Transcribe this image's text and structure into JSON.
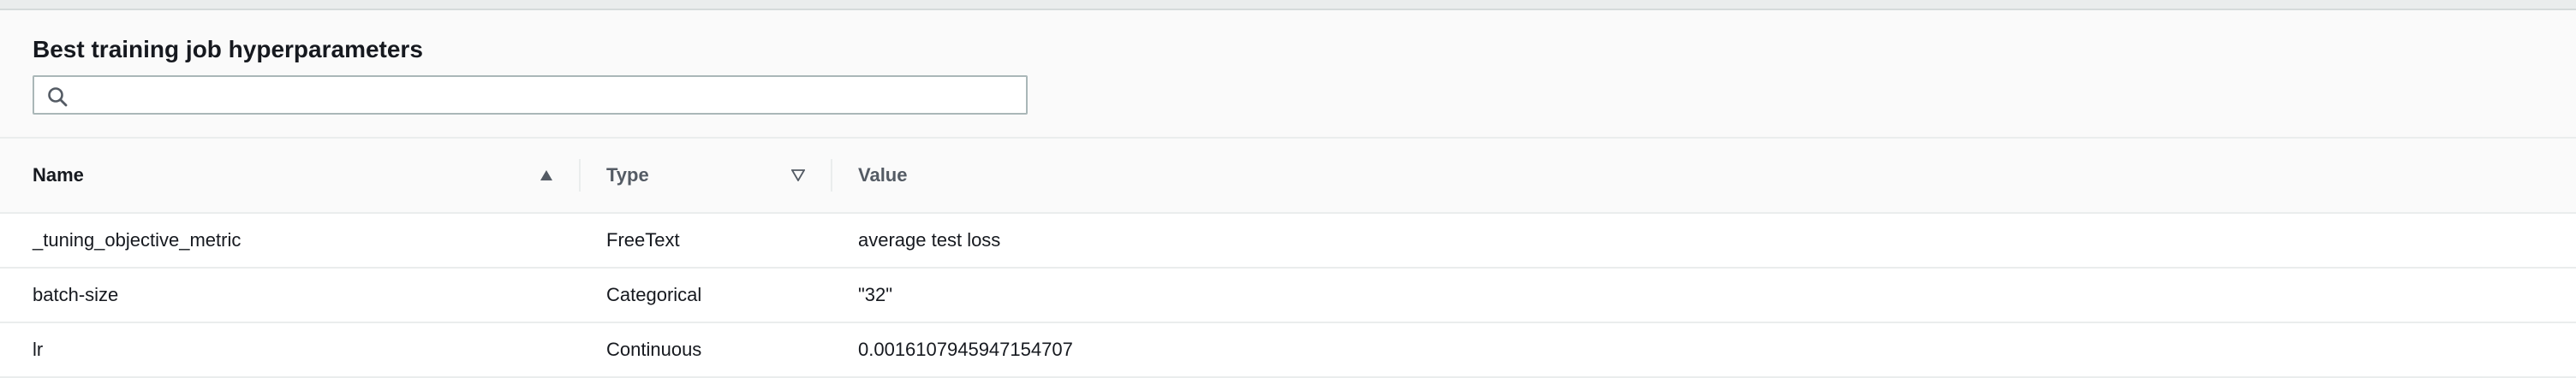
{
  "panel": {
    "title": "Best training job hyperparameters"
  },
  "search": {
    "value": "",
    "placeholder": ""
  },
  "table": {
    "columns": [
      {
        "label": "Name",
        "sort": "ascending"
      },
      {
        "label": "Type",
        "sort": "none"
      },
      {
        "label": "Value",
        "sort": "none"
      }
    ],
    "rows": [
      {
        "name": "_tuning_objective_metric",
        "type": "FreeText",
        "value": "average test loss"
      },
      {
        "name": "batch-size",
        "type": "Categorical",
        "value": "\"32\""
      },
      {
        "name": "lr",
        "type": "Continuous",
        "value": "0.0016107945947154707"
      }
    ]
  },
  "icons": {
    "search": "search-icon",
    "sort_ascending": "sort-ascending-icon",
    "sort_descending": "sort-descending-icon"
  },
  "colors": {
    "header_bg": "#fafafa",
    "border": "#eaeded",
    "input_border": "#aab7b8",
    "text": "#16191f",
    "muted_text": "#545b64"
  }
}
